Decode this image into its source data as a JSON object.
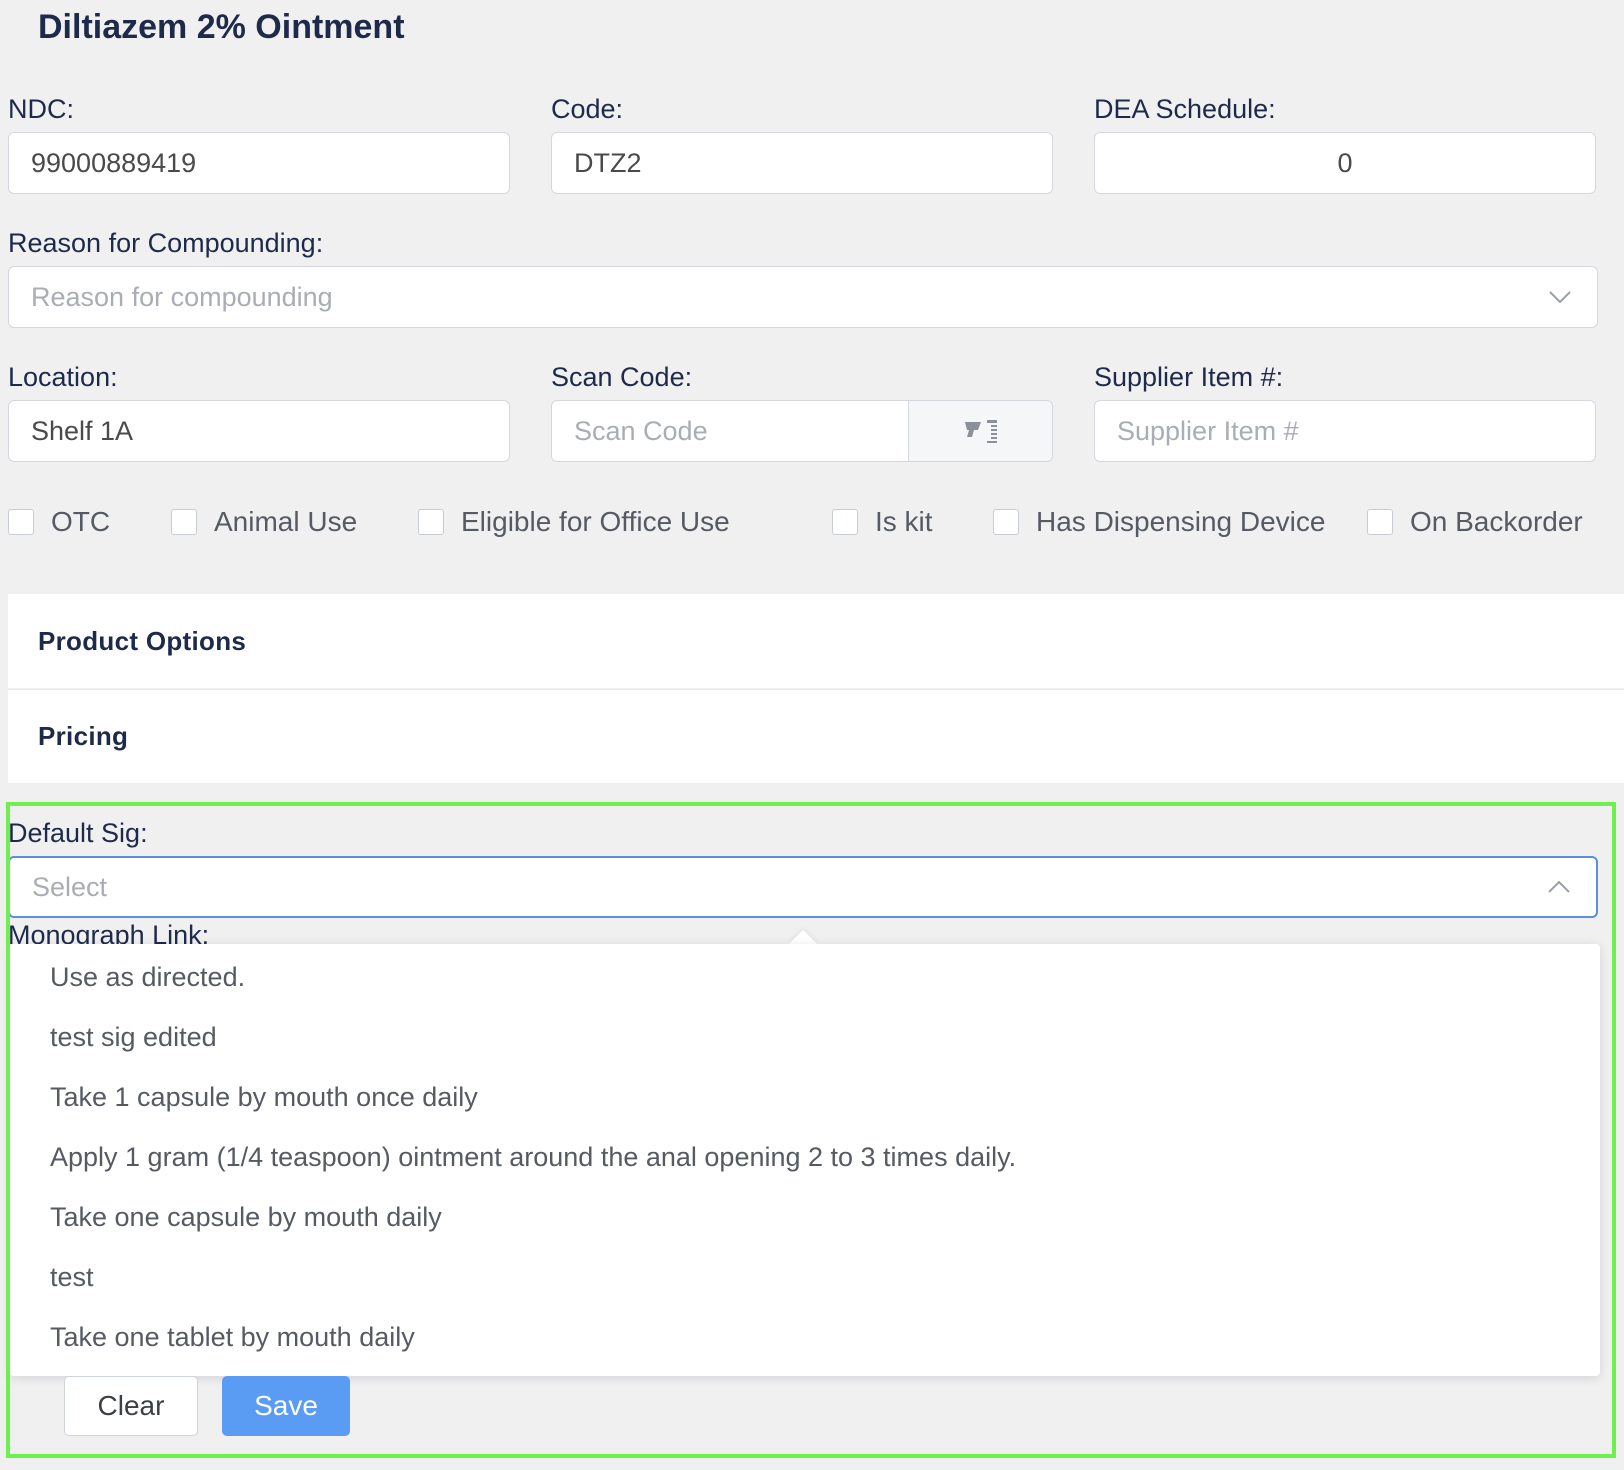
{
  "page": {
    "title": "Diltiazem 2% Ointment"
  },
  "fields": {
    "ndc": {
      "label": "NDC:",
      "value": "99000889419"
    },
    "code": {
      "label": "Code:",
      "value": "DTZ2"
    },
    "dea": {
      "label": "DEA Schedule:",
      "value": "0"
    },
    "reason": {
      "label": "Reason for Compounding:",
      "placeholder": "Reason for compounding"
    },
    "location": {
      "label": "Location:",
      "value": "Shelf 1A"
    },
    "scan_code": {
      "label": "Scan Code:",
      "placeholder": "Scan Code"
    },
    "supplier": {
      "label": "Supplier Item #:",
      "placeholder": "Supplier Item #"
    }
  },
  "checkboxes": {
    "otc": "OTC",
    "animal_use": "Animal Use",
    "office_use": "Eligible for Office Use",
    "is_kit": "Is kit",
    "dispensing_device": "Has Dispensing Device",
    "backorder": "On Backorder"
  },
  "panels": {
    "product_options": "Product Options",
    "pricing": "Pricing"
  },
  "default_sig": {
    "label": "Default Sig:",
    "placeholder": "Select",
    "options": [
      "Use as directed.",
      "test sig edited",
      "Take 1 capsule by mouth once daily",
      "Apply 1 gram (1/4 teaspoon) ointment around the anal opening 2 to 3 times daily.",
      "Take one capsule by mouth daily",
      "test",
      "Take one tablet by mouth daily"
    ]
  },
  "monograph": {
    "label": "Monograph Link:"
  },
  "buttons": {
    "clear": "Clear",
    "save": "Save"
  },
  "colors": {
    "accent": "#5a9bf4",
    "focus_border": "#5b8fd9",
    "highlight": "#6ef04f"
  },
  "icons": {
    "scan": "barcode-scanner-icon",
    "reason_chevron": "chevron-down-icon",
    "sig_chevron": "chevron-up-icon"
  }
}
